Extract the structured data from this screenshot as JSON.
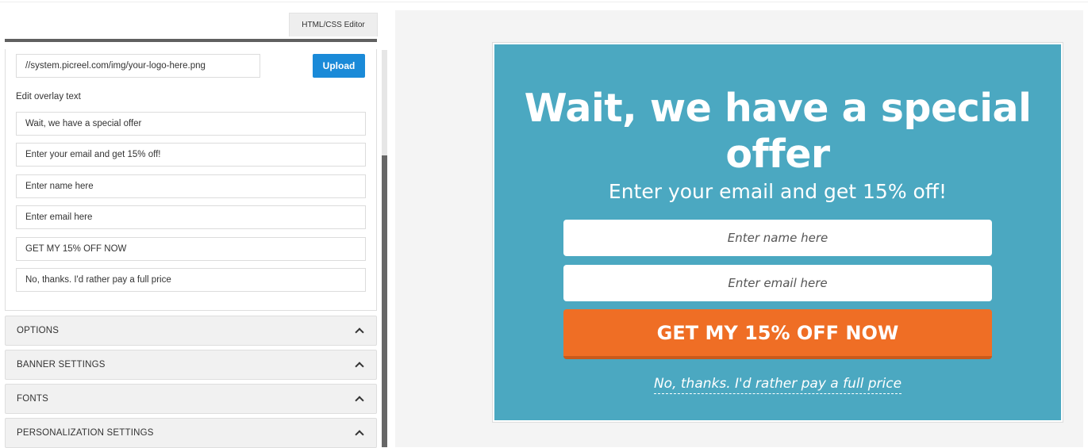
{
  "editor": {
    "tab_label": "HTML/CSS Editor",
    "logo_url_value": "//system.picreel.com/img/your-logo-here.png",
    "upload_label": "Upload",
    "overlay_section_label": "Edit overlay text",
    "fields": [
      {
        "value": "Wait, we have a special offer"
      },
      {
        "value": "Enter your email and get 15% off!"
      },
      {
        "value": "Enter name here"
      },
      {
        "value": "Enter email here"
      },
      {
        "value": "GET MY 15% OFF NOW"
      },
      {
        "value": "No, thanks. I'd rather pay a full price"
      }
    ],
    "accordions": [
      {
        "label": "OPTIONS"
      },
      {
        "label": "BANNER SETTINGS"
      },
      {
        "label": "FONTS"
      },
      {
        "label": "PERSONALIZATION SETTINGS"
      }
    ]
  },
  "preview": {
    "title_line1": "Wait, we have a special",
    "title_line2": "offer",
    "subtitle": "Enter your email and get 15% off!",
    "name_placeholder": "Enter name here",
    "email_placeholder": "Enter email here",
    "cta_label": "GET MY 15% OFF NOW",
    "decline_label": "No, thanks. I'd rather pay a full price"
  },
  "colors": {
    "popup_bg": "#4ba8c1",
    "cta_bg": "#ef6e25",
    "upload_bg": "#1a8ad8"
  }
}
